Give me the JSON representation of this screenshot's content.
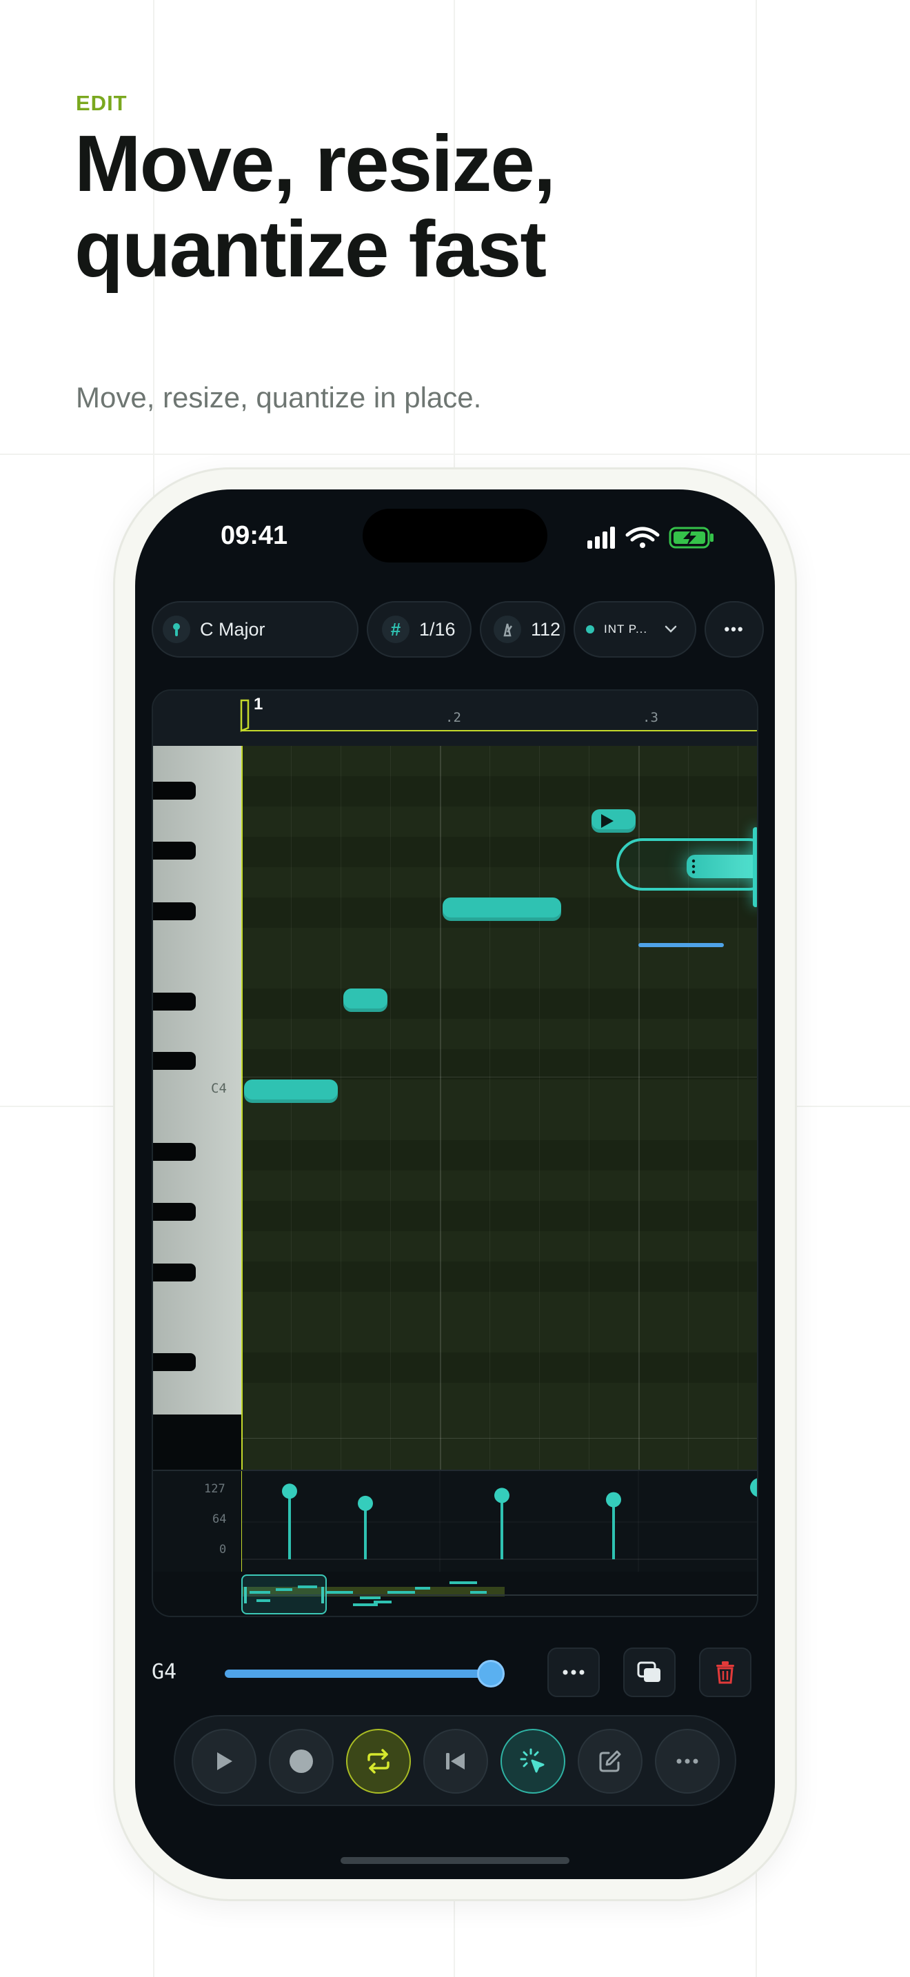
{
  "header": {
    "eyebrow": "EDIT",
    "headline_line1": "Move, resize,",
    "headline_line2": "quantize fast",
    "subhead": "Move, resize, quantize in place."
  },
  "status_bar": {
    "time": "09:41"
  },
  "toolbar": {
    "key": "C Major",
    "grid": "1/16",
    "tempo": "112",
    "instrument": "INT P...",
    "more": "•••"
  },
  "editor": {
    "ruler": {
      "bar1": "1",
      "beat2": ".2",
      "beat3": ".3"
    },
    "c4_label": "C4",
    "velocity_labels": [
      "127",
      "64",
      "0"
    ],
    "velocities": [
      112,
      92,
      105,
      98,
      118
    ],
    "notes": [
      {
        "pitch": "C4",
        "start": 0,
        "length": 0.5,
        "selected": false
      },
      {
        "pitch": "G4",
        "start": 0.5,
        "length": 0.25,
        "selected": false
      },
      {
        "pitch": "C5",
        "start": 1,
        "length": 0.625,
        "selected": false
      },
      {
        "pitch": "D5",
        "start": 1.75,
        "length": 0.25,
        "selected": false
      },
      {
        "pitch": "C5",
        "start": 2.25,
        "length": 0.5,
        "selected": true
      }
    ]
  },
  "selection": {
    "note_name": "G4",
    "velocity_fraction": 0.95
  },
  "colors": {
    "accent": "#2fc2b2",
    "lime": "#c4d92b",
    "blue": "#4fa3e8",
    "red": "#e23a3a",
    "eyebrow": "#7aa81f"
  }
}
